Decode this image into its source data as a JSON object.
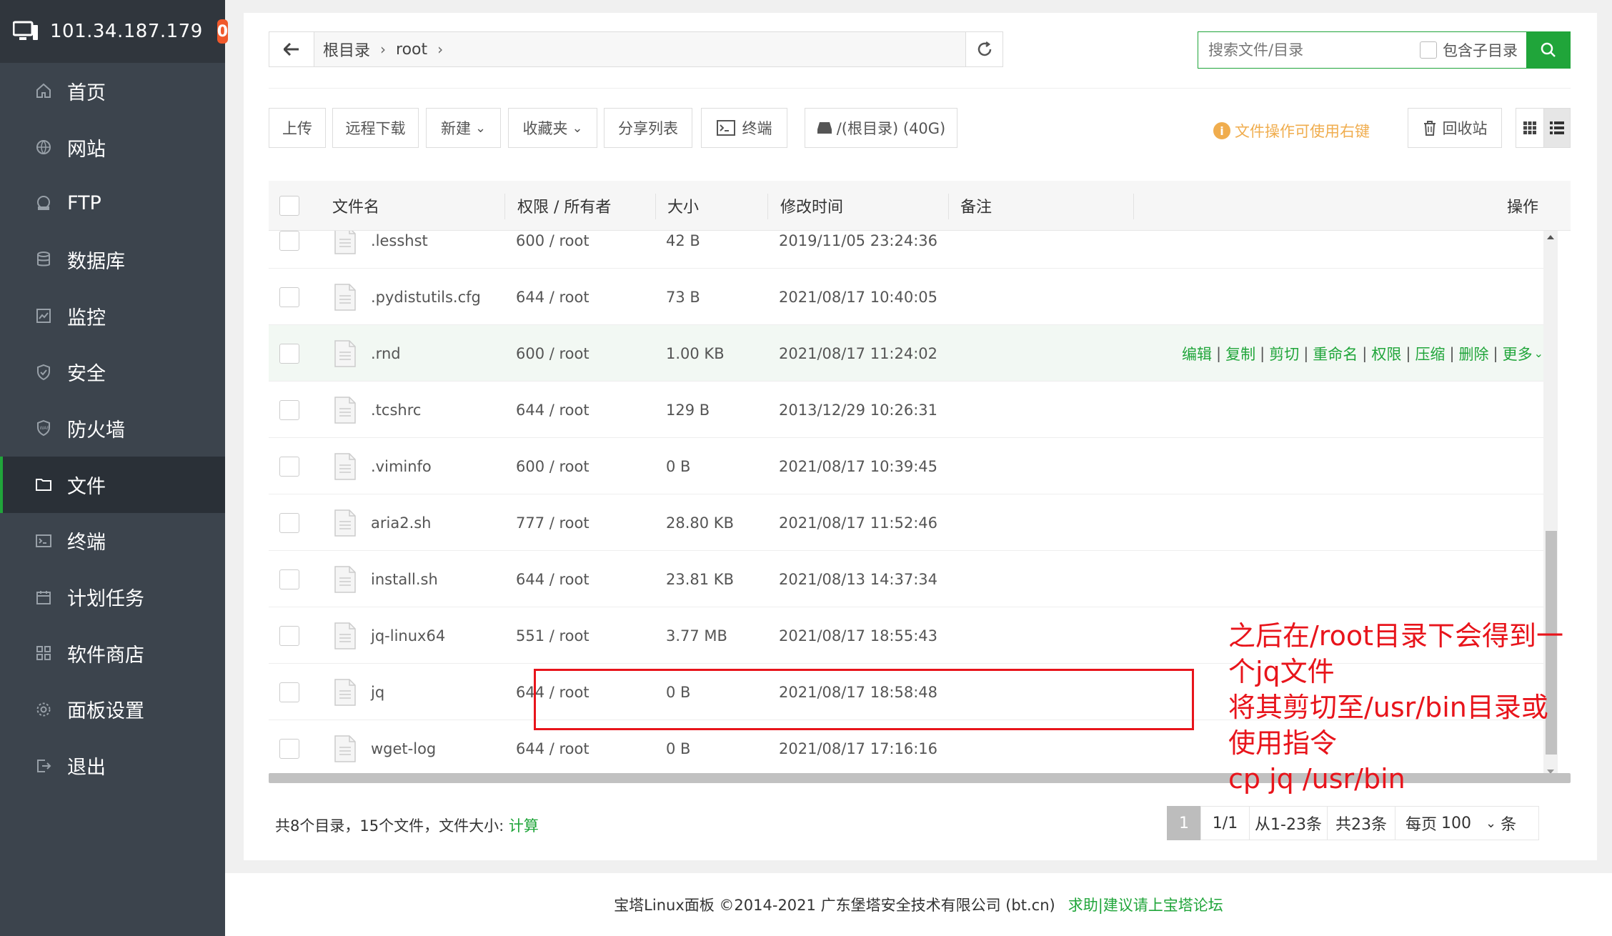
{
  "header": {
    "ip": "101.34.187.179",
    "badge": "0"
  },
  "sidebar": {
    "items": [
      {
        "label": "首页",
        "icon": "home-icon"
      },
      {
        "label": "网站",
        "icon": "globe-icon"
      },
      {
        "label": "FTP",
        "icon": "ftp-icon"
      },
      {
        "label": "数据库",
        "icon": "database-icon"
      },
      {
        "label": "监控",
        "icon": "monitor-icon"
      },
      {
        "label": "安全",
        "icon": "shield-icon"
      },
      {
        "label": "防火墙",
        "icon": "firewall-icon"
      },
      {
        "label": "文件",
        "icon": "folder-icon"
      },
      {
        "label": "终端",
        "icon": "terminal-icon"
      },
      {
        "label": "计划任务",
        "icon": "calendar-icon"
      },
      {
        "label": "软件商店",
        "icon": "grid-icon"
      },
      {
        "label": "面板设置",
        "icon": "gear-icon"
      },
      {
        "label": "退出",
        "icon": "logout-icon"
      }
    ],
    "active_index": 7
  },
  "path": {
    "crumbs": [
      "根目录",
      "root"
    ]
  },
  "search": {
    "placeholder": "搜索文件/目录",
    "subdir_label": "包含子目录"
  },
  "toolbar": {
    "upload": "上传",
    "remote_download": "远程下载",
    "new": "新建",
    "favorites": "收藏夹",
    "share_list": "分享列表",
    "terminal": "终端",
    "disk": "/(根目录) (40G)",
    "tip": "文件操作可使用右键",
    "recycle": "回收站"
  },
  "table": {
    "headers": {
      "name": "文件名",
      "perm": "权限 / 所有者",
      "size": "大小",
      "mtime": "修改时间",
      "note": "备注",
      "ops": "操作"
    },
    "rows": [
      {
        "name": ".lesshst",
        "perm": "600 / root",
        "size": "42 B",
        "mtime": "2019/11/05 23:24:36"
      },
      {
        "name": ".pydistutils.cfg",
        "perm": "644 / root",
        "size": "73 B",
        "mtime": "2021/08/17 10:40:05"
      },
      {
        "name": ".rnd",
        "perm": "600 / root",
        "size": "1.00 KB",
        "mtime": "2021/08/17 11:24:02"
      },
      {
        "name": ".tcshrc",
        "perm": "644 / root",
        "size": "129 B",
        "mtime": "2013/12/29 10:26:31"
      },
      {
        "name": ".viminfo",
        "perm": "600 / root",
        "size": "0 B",
        "mtime": "2021/08/17 10:39:45"
      },
      {
        "name": "aria2.sh",
        "perm": "777 / root",
        "size": "28.80 KB",
        "mtime": "2021/08/17 11:52:46"
      },
      {
        "name": "install.sh",
        "perm": "644 / root",
        "size": "23.81 KB",
        "mtime": "2021/08/13 14:37:34"
      },
      {
        "name": "jq-linux64",
        "perm": "551 / root",
        "size": "3.77 MB",
        "mtime": "2021/08/17 18:55:43"
      },
      {
        "name": "jq",
        "perm": "644 / root",
        "size": "0 B",
        "mtime": "2021/08/17 18:58:48"
      },
      {
        "name": "wget-log",
        "perm": "644 / root",
        "size": "0 B",
        "mtime": "2021/08/17 17:16:16"
      }
    ],
    "hover_row_ops": [
      "编辑",
      "复制",
      "剪切",
      "重命名",
      "权限",
      "压缩",
      "删除",
      "更多"
    ]
  },
  "annotation": {
    "line1": "之后在/root目录下会得到一个jq文件",
    "line2": "将其剪切至/usr/bin目录或使用指令",
    "line3": "cp jq /usr/bin"
  },
  "summary": {
    "text": "共8个目录，15个文件，文件大小: ",
    "calc": "计算"
  },
  "pager": {
    "current": "1",
    "pages": "1/1",
    "range": "从1-23条",
    "total": "共23条",
    "per_page_label": "每页",
    "per_page": "100",
    "unit": "条"
  },
  "footer": {
    "text": "宝塔Linux面板 ©2014-2021 广东堡塔安全技术有限公司 (bt.cn)",
    "link": "求助|建议请上宝塔论坛"
  },
  "colors": {
    "accent": "#20a53a",
    "sidebar": "#3c444d",
    "annotation": "#e8141b",
    "tip": "#f0ad4e"
  }
}
